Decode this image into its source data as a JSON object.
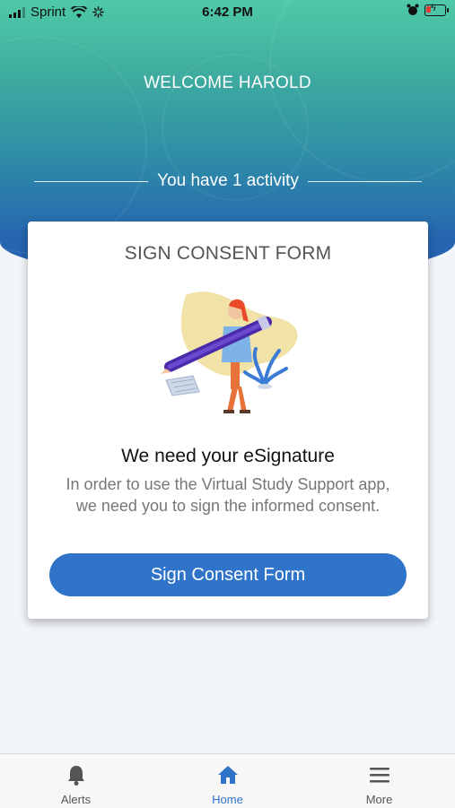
{
  "status_bar": {
    "carrier": "Sprint",
    "time": "6:42 PM"
  },
  "header": {
    "welcome": "WELCOME HAROLD",
    "activity_summary": "You have 1 activity"
  },
  "card": {
    "title": "SIGN CONSENT FORM",
    "heading": "We need your eSignature",
    "body": "In order to use the Virtual Study Support app, we need you to sign the informed consent.",
    "button_label": "Sign Consent Form"
  },
  "tabs": [
    {
      "label": "Alerts",
      "icon": "bell-icon",
      "active": false
    },
    {
      "label": "Home",
      "icon": "home-icon",
      "active": true
    },
    {
      "label": "More",
      "icon": "menu-icon",
      "active": false
    }
  ],
  "colors": {
    "accent": "#2f74c9",
    "header_top": "#4fc9a8",
    "header_bottom": "#245fb2"
  }
}
